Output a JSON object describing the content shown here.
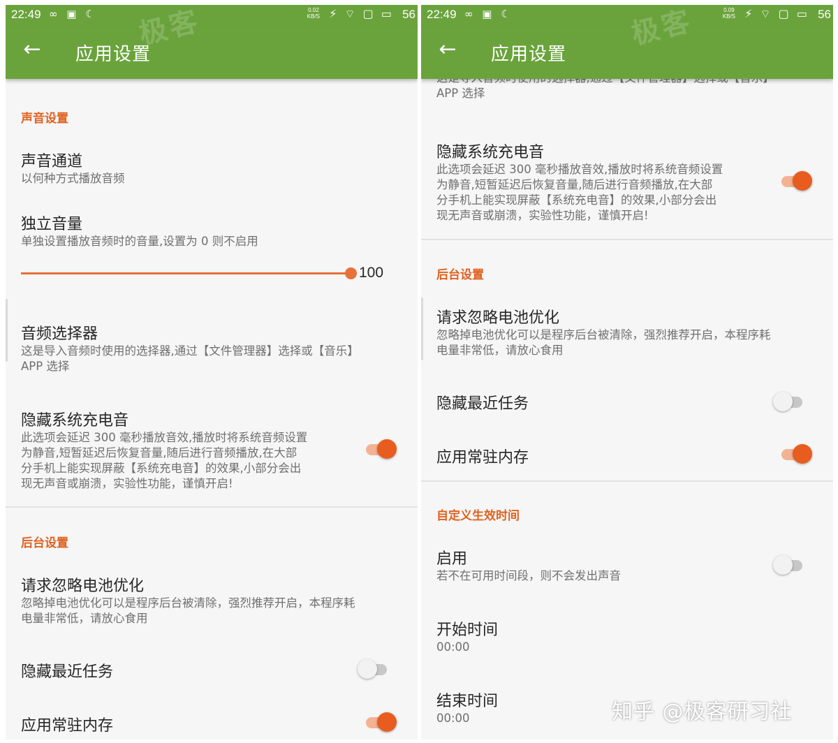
{
  "status": {
    "time": "22:49",
    "left_icons": "∞ ▣ ☾",
    "right_icons": "⚡ ⌔ ▢ ▭",
    "battery": "56",
    "rate_left": "0.02",
    "rate_right": "0.09",
    "rate_unit": "KB/S"
  },
  "appbar": {
    "title": "应用设置",
    "back_icon": "←"
  },
  "watermark": "极客",
  "sections": {
    "sound": "声音设置",
    "background": "后台设置",
    "custom_time": "自定义生效时间"
  },
  "items": {
    "channel": {
      "title": "声音通道",
      "sub": "以何种方式播放音频"
    },
    "volume": {
      "title": "独立音量",
      "sub": "单独设置播放音频时的音量,设置为 0 则不启用",
      "value": "100",
      "level": 100
    },
    "selector": {
      "title": "音频选择器",
      "sub_1": "这是导入音频时使用的选择器,通过【文件管理器】选择或【音乐】",
      "sub_2": "APP 选择"
    },
    "hide_charge": {
      "title": "隐藏系统充电音",
      "sub_1": "此选项会延迟 300 毫秒播放音效,播放时将系统音频设置",
      "sub_2": "为静音,短暂延迟后恢复音量,随后进行音频播放,在大部",
      "sub_3": "分手机上能实现屏蔽【系统充电音】的效果,小部分会出",
      "sub_4": "现无声音或崩溃，实验性功能，谨慎开启!",
      "enabled": true
    },
    "battery_opt": {
      "title": "请求忽略电池优化",
      "sub_1": "忽略掉电池优化可以是程序后台被清除，强烈推荐开启，本程序耗",
      "sub_2": "电量非常低，请放心食用"
    },
    "hide_recent": {
      "title": "隐藏最近任务",
      "enabled": false
    },
    "resident": {
      "title": "应用常驻内存",
      "enabled": true
    },
    "enable": {
      "title": "启用",
      "sub": "若不在可用时间段，则不会发出声音",
      "enabled": false
    },
    "start_time": {
      "title": "开始时间",
      "value": "00:00"
    },
    "end_time": {
      "title": "结束时间",
      "value": "00:00"
    }
  },
  "right_partial_top": "这是导入音频时使用的选择器,通过【文件管理器】选择或【音乐】",
  "zhihu_watermark": "知乎 @极客研习社"
}
